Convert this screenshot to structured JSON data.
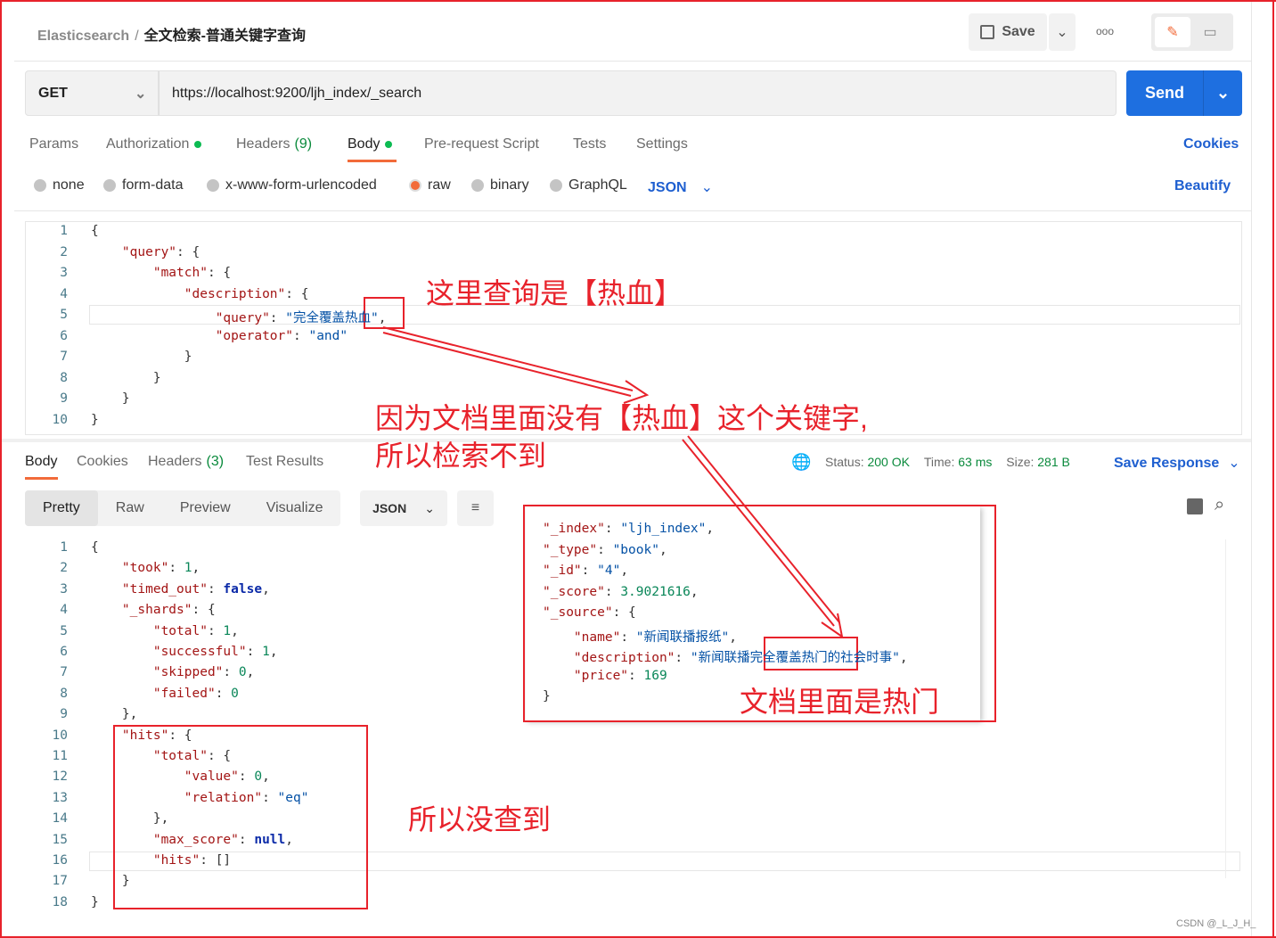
{
  "header": {
    "breadcrumb_root": "Elasticsearch",
    "breadcrumb_sep": "/",
    "title": "全文检索-普通关键字查询",
    "save_label": "Save",
    "more": "ooo"
  },
  "request": {
    "method": "GET",
    "url": "https://localhost:9200/ljh_index/_search",
    "send_label": "Send",
    "tabs": [
      {
        "label": "Params"
      },
      {
        "label": "Authorization",
        "dot": true
      },
      {
        "label": "Headers",
        "count": "(9)"
      },
      {
        "label": "Body",
        "dot": true,
        "active": true
      },
      {
        "label": "Pre-request Script"
      },
      {
        "label": "Tests"
      },
      {
        "label": "Settings"
      }
    ],
    "cookies_label": "Cookies",
    "body_types": [
      "none",
      "form-data",
      "x-www-form-urlencoded",
      "raw",
      "binary",
      "GraphQL"
    ],
    "selected_body_type": "raw",
    "format": "JSON",
    "beautify_label": "Beautify",
    "code": [
      [
        [
          "{",
          "p"
        ]
      ],
      [
        [
          "    ",
          ""
        ],
        [
          "\"query\"",
          "k"
        ],
        [
          ": {",
          "p"
        ]
      ],
      [
        [
          "        ",
          ""
        ],
        [
          "\"match\"",
          "k"
        ],
        [
          ": {",
          "p"
        ]
      ],
      [
        [
          "            ",
          ""
        ],
        [
          "\"description\"",
          "k"
        ],
        [
          ": {",
          "p"
        ]
      ],
      [
        [
          "                ",
          ""
        ],
        [
          "\"query\"",
          "k"
        ],
        [
          ": ",
          "p"
        ],
        [
          "\"完全覆盖热血\"",
          "s"
        ],
        [
          ",",
          "p"
        ]
      ],
      [
        [
          "                ",
          ""
        ],
        [
          "\"operator\"",
          "k"
        ],
        [
          ": ",
          "p"
        ],
        [
          "\"and\"",
          "s"
        ]
      ],
      [
        [
          "            ",
          ""
        ],
        [
          "}",
          "p"
        ]
      ],
      [
        [
          "        ",
          ""
        ],
        [
          "}",
          "p"
        ]
      ],
      [
        [
          "    ",
          ""
        ],
        [
          "}",
          "p"
        ]
      ],
      [
        [
          "}",
          "p"
        ]
      ]
    ]
  },
  "response": {
    "tabs": [
      {
        "label": "Body",
        "active": true
      },
      {
        "label": "Cookies"
      },
      {
        "label": "Headers",
        "count": "(3)"
      },
      {
        "label": "Test Results"
      }
    ],
    "status_label": "Status:",
    "status": "200 OK",
    "time_label": "Time:",
    "time": "63 ms",
    "size_label": "Size:",
    "size": "281 B",
    "save_response": "Save Response",
    "views": [
      "Pretty",
      "Raw",
      "Preview",
      "Visualize"
    ],
    "active_view": "Pretty",
    "format": "JSON",
    "code": [
      [
        [
          "{",
          "p"
        ]
      ],
      [
        [
          "    ",
          ""
        ],
        [
          "\"took\"",
          "k"
        ],
        [
          ": ",
          "p"
        ],
        [
          "1",
          "n"
        ],
        [
          ",",
          "p"
        ]
      ],
      [
        [
          "    ",
          ""
        ],
        [
          "\"timed_out\"",
          "k"
        ],
        [
          ": ",
          "p"
        ],
        [
          "false",
          "b"
        ],
        [
          ",",
          "p"
        ]
      ],
      [
        [
          "    ",
          ""
        ],
        [
          "\"_shards\"",
          "k"
        ],
        [
          ": {",
          "p"
        ]
      ],
      [
        [
          "        ",
          ""
        ],
        [
          "\"total\"",
          "k"
        ],
        [
          ": ",
          "p"
        ],
        [
          "1",
          "n"
        ],
        [
          ",",
          "p"
        ]
      ],
      [
        [
          "        ",
          ""
        ],
        [
          "\"successful\"",
          "k"
        ],
        [
          ": ",
          "p"
        ],
        [
          "1",
          "n"
        ],
        [
          ",",
          "p"
        ]
      ],
      [
        [
          "        ",
          ""
        ],
        [
          "\"skipped\"",
          "k"
        ],
        [
          ": ",
          "p"
        ],
        [
          "0",
          "n"
        ],
        [
          ",",
          "p"
        ]
      ],
      [
        [
          "        ",
          ""
        ],
        [
          "\"failed\"",
          "k"
        ],
        [
          ": ",
          "p"
        ],
        [
          "0",
          "n"
        ]
      ],
      [
        [
          "    ",
          ""
        ],
        [
          "},",
          "p"
        ]
      ],
      [
        [
          "    ",
          ""
        ],
        [
          "\"hits\"",
          "k"
        ],
        [
          ": {",
          "p"
        ]
      ],
      [
        [
          "        ",
          ""
        ],
        [
          "\"total\"",
          "k"
        ],
        [
          ": {",
          "p"
        ]
      ],
      [
        [
          "            ",
          ""
        ],
        [
          "\"value\"",
          "k"
        ],
        [
          ": ",
          "p"
        ],
        [
          "0",
          "n"
        ],
        [
          ",",
          "p"
        ]
      ],
      [
        [
          "            ",
          ""
        ],
        [
          "\"relation\"",
          "k"
        ],
        [
          ": ",
          "p"
        ],
        [
          "\"eq\"",
          "s"
        ]
      ],
      [
        [
          "        ",
          ""
        ],
        [
          "},",
          "p"
        ]
      ],
      [
        [
          "        ",
          ""
        ],
        [
          "\"max_score\"",
          "k"
        ],
        [
          ": ",
          "p"
        ],
        [
          "null",
          "b"
        ],
        [
          ",",
          "p"
        ]
      ],
      [
        [
          "        ",
          ""
        ],
        [
          "\"hits\"",
          "k"
        ],
        [
          ": ",
          "p"
        ],
        [
          "[]",
          "p"
        ]
      ],
      [
        [
          "    ",
          ""
        ],
        [
          "}",
          "p"
        ]
      ],
      [
        [
          "}",
          "p"
        ]
      ]
    ]
  },
  "overlay": {
    "code": [
      [
        [
          "\"_index\"",
          "k"
        ],
        [
          ": ",
          "p"
        ],
        [
          "\"ljh_index\"",
          "s"
        ],
        [
          ",",
          "p"
        ]
      ],
      [
        [
          "\"_type\"",
          "k"
        ],
        [
          ": ",
          "p"
        ],
        [
          "\"book\"",
          "s"
        ],
        [
          ",",
          "p"
        ]
      ],
      [
        [
          "\"_id\"",
          "k"
        ],
        [
          ": ",
          "p"
        ],
        [
          "\"4\"",
          "s"
        ],
        [
          ",",
          "p"
        ]
      ],
      [
        [
          "\"_score\"",
          "k"
        ],
        [
          ": ",
          "p"
        ],
        [
          "3.9021616",
          "n"
        ],
        [
          ",",
          "p"
        ]
      ],
      [
        [
          "\"_source\"",
          "k"
        ],
        [
          ": {",
          "p"
        ]
      ],
      [
        [
          "    ",
          ""
        ],
        [
          "\"name\"",
          "k"
        ],
        [
          ": ",
          "p"
        ],
        [
          "\"新闻联播报纸\"",
          "s"
        ],
        [
          ",",
          "p"
        ]
      ],
      [
        [
          "    ",
          ""
        ],
        [
          "\"description\"",
          "k"
        ],
        [
          ": ",
          "p"
        ],
        [
          "\"新闻联播完全覆盖热门的社会时事\"",
          "s"
        ],
        [
          ",",
          "p"
        ]
      ],
      [
        [
          "    ",
          ""
        ],
        [
          "\"price\"",
          "k"
        ],
        [
          ": ",
          "p"
        ],
        [
          "169",
          "n"
        ]
      ],
      [
        [
          "}",
          "p"
        ]
      ]
    ]
  },
  "annotations": {
    "a1": "这里查询是【热血】",
    "a2_line1": "因为文档里面没有【热血】这个关键字,",
    "a2_line2": "所以检索不到",
    "a3": "文档里面是热门",
    "a4": "所以没查到"
  },
  "watermark": "CSDN @_L_J_H_",
  "colors": {
    "accent": "#1e6fe0",
    "tab_indicator": "#f26b3a",
    "annotation": "#e8222b",
    "ok": "#0a8a3c"
  }
}
